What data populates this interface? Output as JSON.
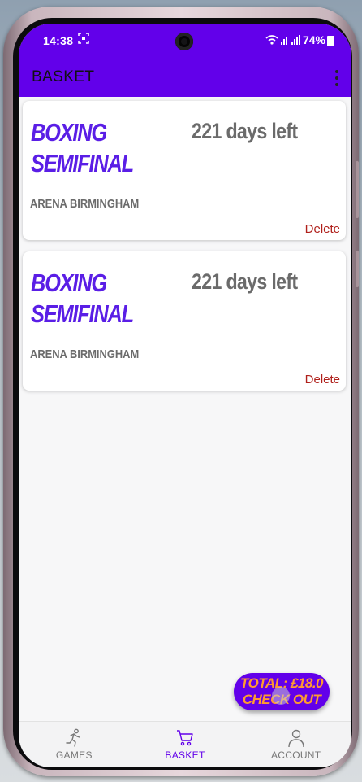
{
  "status_bar": {
    "time": "14:38",
    "screenshot_icon": "screenshot-icon",
    "signal_icons": "wifi signal signal",
    "battery_percent": "74%"
  },
  "app_bar": {
    "title": "BASKET",
    "menu_icon": "more-vert-icon"
  },
  "basket_items": [
    {
      "event_name": "BOXING SEMIFINAL",
      "days_left": "221 days left",
      "venue": "ARENA BIRMINGHAM",
      "delete_label": "Delete"
    },
    {
      "event_name": "BOXING SEMIFINAL",
      "days_left": "221 days left",
      "venue": "ARENA BIRMINGHAM",
      "delete_label": "Delete"
    }
  ],
  "checkout": {
    "total_label": "TOTAL: £18.0",
    "action_label": "CHECK OUT"
  },
  "bottom_nav": {
    "items": [
      {
        "label": "GAMES",
        "icon": "running-person-icon",
        "active": false
      },
      {
        "label": "BASKET",
        "icon": "shopping-cart-icon",
        "active": true
      },
      {
        "label": "ACCOUNT",
        "icon": "person-icon",
        "active": false
      }
    ]
  },
  "colors": {
    "primary": "#6200ea",
    "event_name": "#5a1ee6",
    "delete": "#b0201b",
    "checkout_text": "#ff9b30",
    "muted_text": "#6b6b6b"
  }
}
